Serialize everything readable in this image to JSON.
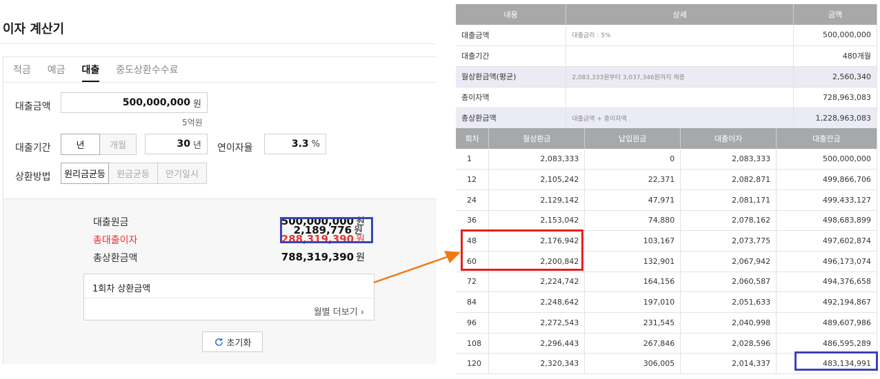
{
  "calculator": {
    "title": "이자 계산기",
    "tabs": [
      {
        "label": "적금",
        "active": false
      },
      {
        "label": "예금",
        "active": false
      },
      {
        "label": "대출",
        "active": true
      },
      {
        "label": "중도상환수수료",
        "active": false
      }
    ],
    "loan_amount": {
      "label": "대출금액",
      "value": "500,000,000",
      "unit": "원",
      "hint": "5억원"
    },
    "loan_period": {
      "label": "대출기간",
      "unit_options": [
        "년",
        "개월"
      ],
      "selected_unit": "년",
      "value": "30",
      "unit": "년"
    },
    "interest_rate": {
      "label": "연이자율",
      "value": "3.3",
      "unit": "%"
    },
    "repayment": {
      "label": "상환방법",
      "options": [
        "원리금균등",
        "원금균등",
        "만기일시"
      ],
      "selected": "원리금균등"
    },
    "results": {
      "principal": {
        "label": "대출원금",
        "value": "500,000,000",
        "unit": "원"
      },
      "total_interest": {
        "label": "총대출이자",
        "value": "288,319,390",
        "unit": "원"
      },
      "total_repay": {
        "label": "총상환금액",
        "value": "788,319,390",
        "unit": "원"
      },
      "first_payment": {
        "label": "1회차 상환금액",
        "value": "2,189,776",
        "unit": "원"
      },
      "more_label": "월별 더보기",
      "reset_label": "초기화"
    }
  },
  "summary": {
    "headers": [
      "내용",
      "상세",
      "금액"
    ],
    "rows": [
      {
        "label": "대출금액",
        "detail": "대출금리 : 5%",
        "amount": "500,000,000"
      },
      {
        "label": "대출기간",
        "detail": "",
        "amount": "480개월"
      },
      {
        "label": "월상환금액(평균)",
        "detail": "2,083,333원부터 3,037,346원까지 체증",
        "amount": "2,560,340"
      },
      {
        "label": "총이자액",
        "detail": "",
        "amount": "728,963,083"
      },
      {
        "label": "총상환금액",
        "detail": "대출금액 + 총이자액",
        "amount": "1,228,963,083"
      }
    ]
  },
  "schedule": {
    "headers": [
      "회차",
      "월상환금",
      "납입원금",
      "대출이자",
      "대출잔금"
    ],
    "rows": [
      [
        "1",
        "2,083,333",
        "0",
        "2,083,333",
        "500,000,000"
      ],
      [
        "12",
        "2,105,242",
        "22,371",
        "2,082,871",
        "499,866,706"
      ],
      [
        "24",
        "2,129,142",
        "47,971",
        "2,081,171",
        "499,433,127"
      ],
      [
        "36",
        "2,153,042",
        "74,880",
        "2,078,162",
        "498,683,899"
      ],
      [
        "48",
        "2,176,942",
        "103,167",
        "2,073,775",
        "497,602,874"
      ],
      [
        "60",
        "2,200,842",
        "132,901",
        "2,067,942",
        "496,173,074"
      ],
      [
        "72",
        "2,224,742",
        "164,156",
        "2,060,587",
        "494,376,658"
      ],
      [
        "84",
        "2,248,642",
        "197,010",
        "2,051,633",
        "492,194,867"
      ],
      [
        "96",
        "2,272,543",
        "231,545",
        "2,040,998",
        "489,607,986"
      ],
      [
        "108",
        "2,296,443",
        "267,846",
        "2,028,596",
        "486,595,289"
      ],
      [
        "120",
        "2,320,343",
        "306,005",
        "2,014,337",
        "483,134,991"
      ]
    ]
  },
  "colors": {
    "red_highlight": "#e02020",
    "blue_highlight": "#3b44b6",
    "arrow": "#f07a10",
    "header_gray": "#a6a8aa"
  }
}
